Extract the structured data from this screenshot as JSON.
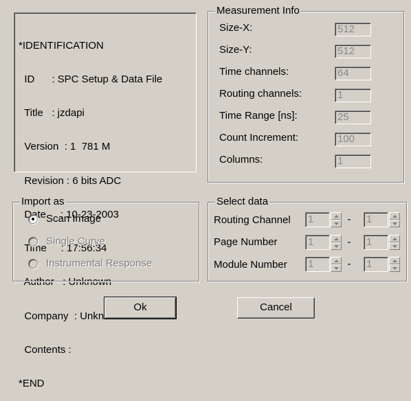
{
  "identification": {
    "lines": [
      "*IDENTIFICATION",
      "  ID      : SPC Setup & Data File",
      "  Title   : jzdapi",
      "  Version  : 1  781 M",
      "  Revision : 6 bits ADC",
      "  Date     : 10-23-2003",
      "  Time     : 17:56:34",
      "  Author   : Unknown",
      "  Company  : Unknown",
      "  Contents :",
      "*END"
    ]
  },
  "measurement_info": {
    "title": "Measurement Info",
    "rows": [
      {
        "label": "Size-X:",
        "value": "512"
      },
      {
        "label": "Size-Y:",
        "value": "512"
      },
      {
        "label": "Time channels:",
        "value": "64"
      },
      {
        "label": "Routing channels:",
        "value": "1"
      },
      {
        "label": "Time Range [ns]:",
        "value": "25"
      },
      {
        "label": "Count Increment:",
        "value": "100"
      },
      {
        "label": "Columns:",
        "value": "1"
      }
    ]
  },
  "import_as": {
    "title": "Import as",
    "options": [
      {
        "label": "Scan Image",
        "selected": true,
        "enabled": true
      },
      {
        "label": "Single Curve",
        "selected": false,
        "enabled": false
      },
      {
        "label": "Instrumental Response",
        "selected": false,
        "enabled": false
      }
    ]
  },
  "select_data": {
    "title": "Select data",
    "rows": [
      {
        "label": "Routing Channel",
        "from": "1",
        "to": "1"
      },
      {
        "label": "Page Number",
        "from": "1",
        "to": "1"
      },
      {
        "label": "Module Number",
        "from": "1",
        "to": "1"
      }
    ],
    "separator": "-"
  },
  "buttons": {
    "ok": "Ok",
    "cancel": "Cancel"
  }
}
